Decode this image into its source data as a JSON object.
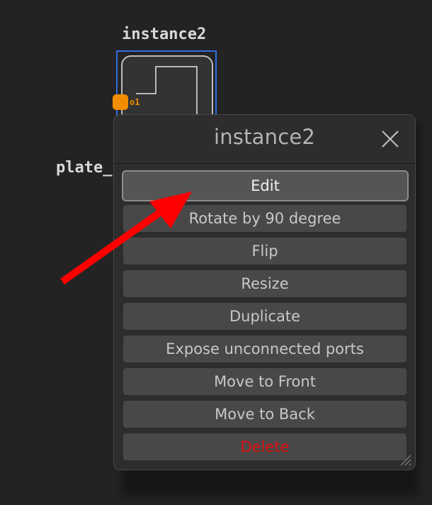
{
  "canvas": {
    "instance_label": "instance2",
    "plate_label": "plate_",
    "port_label": "o1"
  },
  "dialog": {
    "title": "instance2",
    "close_icon": "close-icon",
    "items": [
      {
        "label": "Edit"
      },
      {
        "label": "Rotate by 90 degree"
      },
      {
        "label": "Flip"
      },
      {
        "label": "Resize"
      },
      {
        "label": "Duplicate"
      },
      {
        "label": "Expose unconnected ports"
      },
      {
        "label": "Move to Front"
      },
      {
        "label": "Move to Back"
      },
      {
        "label": "Delete"
      }
    ]
  },
  "colors": {
    "background": "#232323",
    "selection": "#2f6fe0",
    "port": "#f28c00",
    "delete_text": "#e01010",
    "annotation_arrow": "#ff0000"
  }
}
